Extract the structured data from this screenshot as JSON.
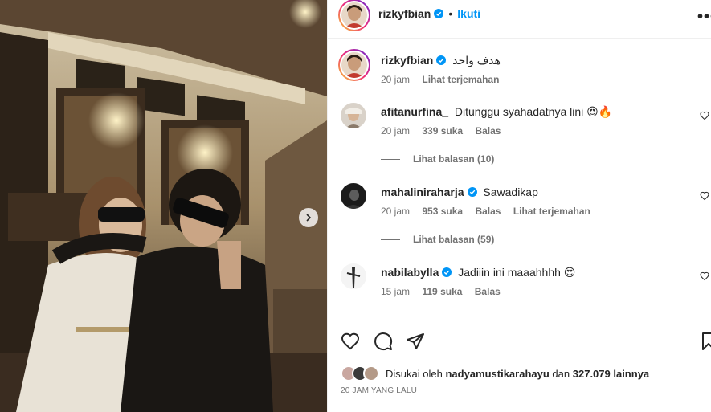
{
  "post": {
    "next_icon": "chevron-right-icon"
  },
  "header": {
    "username": "rizkyfbian",
    "separator": "•",
    "follow_label": "Ikuti",
    "more_icon": "more-horizontal-icon"
  },
  "caption": {
    "username": "rizkyfbian",
    "text": "هدف واحد",
    "time": "20 jam",
    "translate_label": "Lihat terjemahan"
  },
  "comments": [
    {
      "username": "afitanurfina_",
      "verified": false,
      "text": "Ditunggu syahadatnya lini",
      "emoji": "😍🔥",
      "time": "20 jam",
      "likes": "339 suka",
      "reply_label": "Balas",
      "translate_label": "",
      "replies_label": "Lihat balasan (10)"
    },
    {
      "username": "mahaliniraharja",
      "verified": true,
      "text": "Sawadikap",
      "emoji": "",
      "time": "20 jam",
      "likes": "953 suka",
      "reply_label": "Balas",
      "translate_label": "Lihat terjemahan",
      "replies_label": "Lihat balasan (59)"
    },
    {
      "username": "nabilabylla",
      "verified": true,
      "text": "Jadiiin ini maaahhhh",
      "emoji": "😍",
      "time": "15 jam",
      "likes": "119 suka",
      "reply_label": "Balas",
      "translate_label": "",
      "replies_label": ""
    }
  ],
  "actions": {
    "like_icon": "heart-icon",
    "comment_icon": "comment-icon",
    "share_icon": "send-icon",
    "save_icon": "bookmark-icon"
  },
  "likes_line": {
    "prefix": "Disukai oleh",
    "user": "nadyamustikarahayu",
    "middle": "dan",
    "count": "327.079 lainnya"
  },
  "time_ago": "20 JAM YANG LALU",
  "colors": {
    "accent": "#0095f6",
    "muted": "#737373",
    "text": "#262626"
  }
}
